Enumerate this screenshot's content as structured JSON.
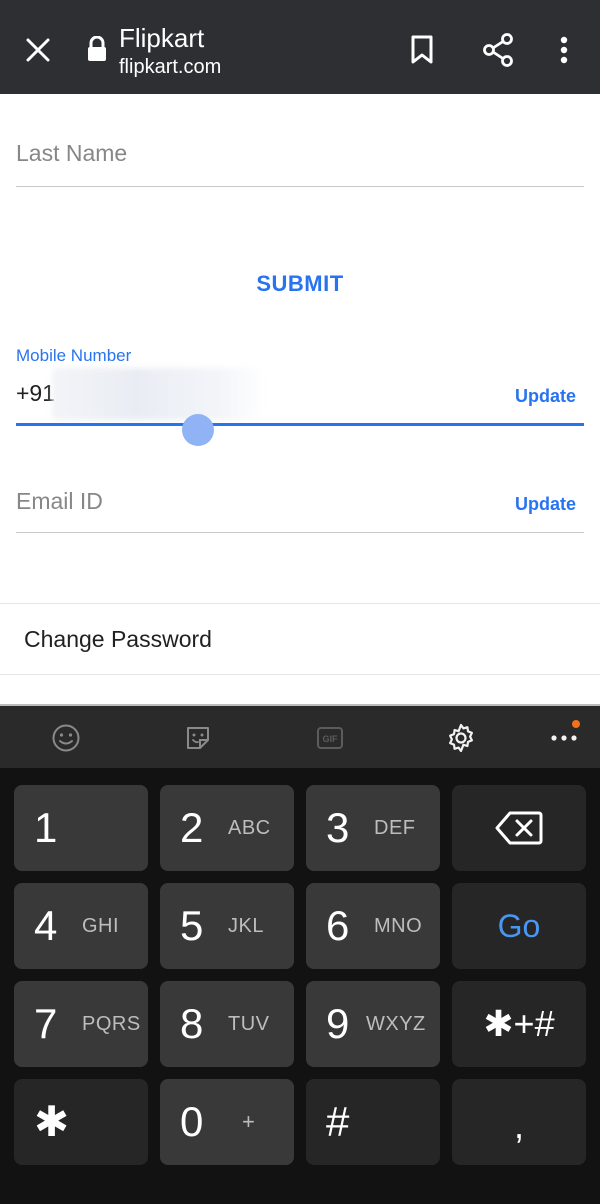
{
  "browser": {
    "title": "Flipkart",
    "url": "flipkart.com",
    "icons": {
      "close": "close-icon",
      "lock": "lock-icon",
      "bookmark": "bookmark-icon",
      "share": "share-icon",
      "menu": "more-vertical-icon"
    }
  },
  "form": {
    "last_name_placeholder": "Last Name",
    "submit_label": "SUBMIT",
    "mobile": {
      "label": "Mobile Number",
      "prefix": "+91",
      "update_label": "Update"
    },
    "email": {
      "placeholder": "Email ID",
      "update_label": "Update"
    }
  },
  "account_menu": {
    "change_password": "Change Password"
  },
  "keyboard": {
    "toolbar_icons": [
      "emoji-icon",
      "sticker-icon",
      "gif-icon",
      "settings-icon",
      "more-horizontal-icon"
    ],
    "gif_label": "GIF",
    "rows": [
      [
        {
          "num": "1",
          "letters": ""
        },
        {
          "num": "2",
          "letters": "ABC"
        },
        {
          "num": "3",
          "letters": "DEF"
        }
      ],
      [
        {
          "num": "4",
          "letters": "GHI"
        },
        {
          "num": "5",
          "letters": "JKL"
        },
        {
          "num": "6",
          "letters": "MNO"
        }
      ],
      [
        {
          "num": "7",
          "letters": "PQRS"
        },
        {
          "num": "8",
          "letters": "TUV"
        },
        {
          "num": "9",
          "letters": "WXYZ"
        }
      ]
    ],
    "go_label": "Go",
    "symbols_label": "✱+#",
    "asterisk_label": "✱",
    "zero": {
      "num": "0",
      "sub": "+"
    },
    "hash_label": "#",
    "comma_label": ",",
    "colors": {
      "accent": "#2874f0",
      "go_blue": "#4a97f3",
      "notification_dot": "#f0711a"
    }
  }
}
